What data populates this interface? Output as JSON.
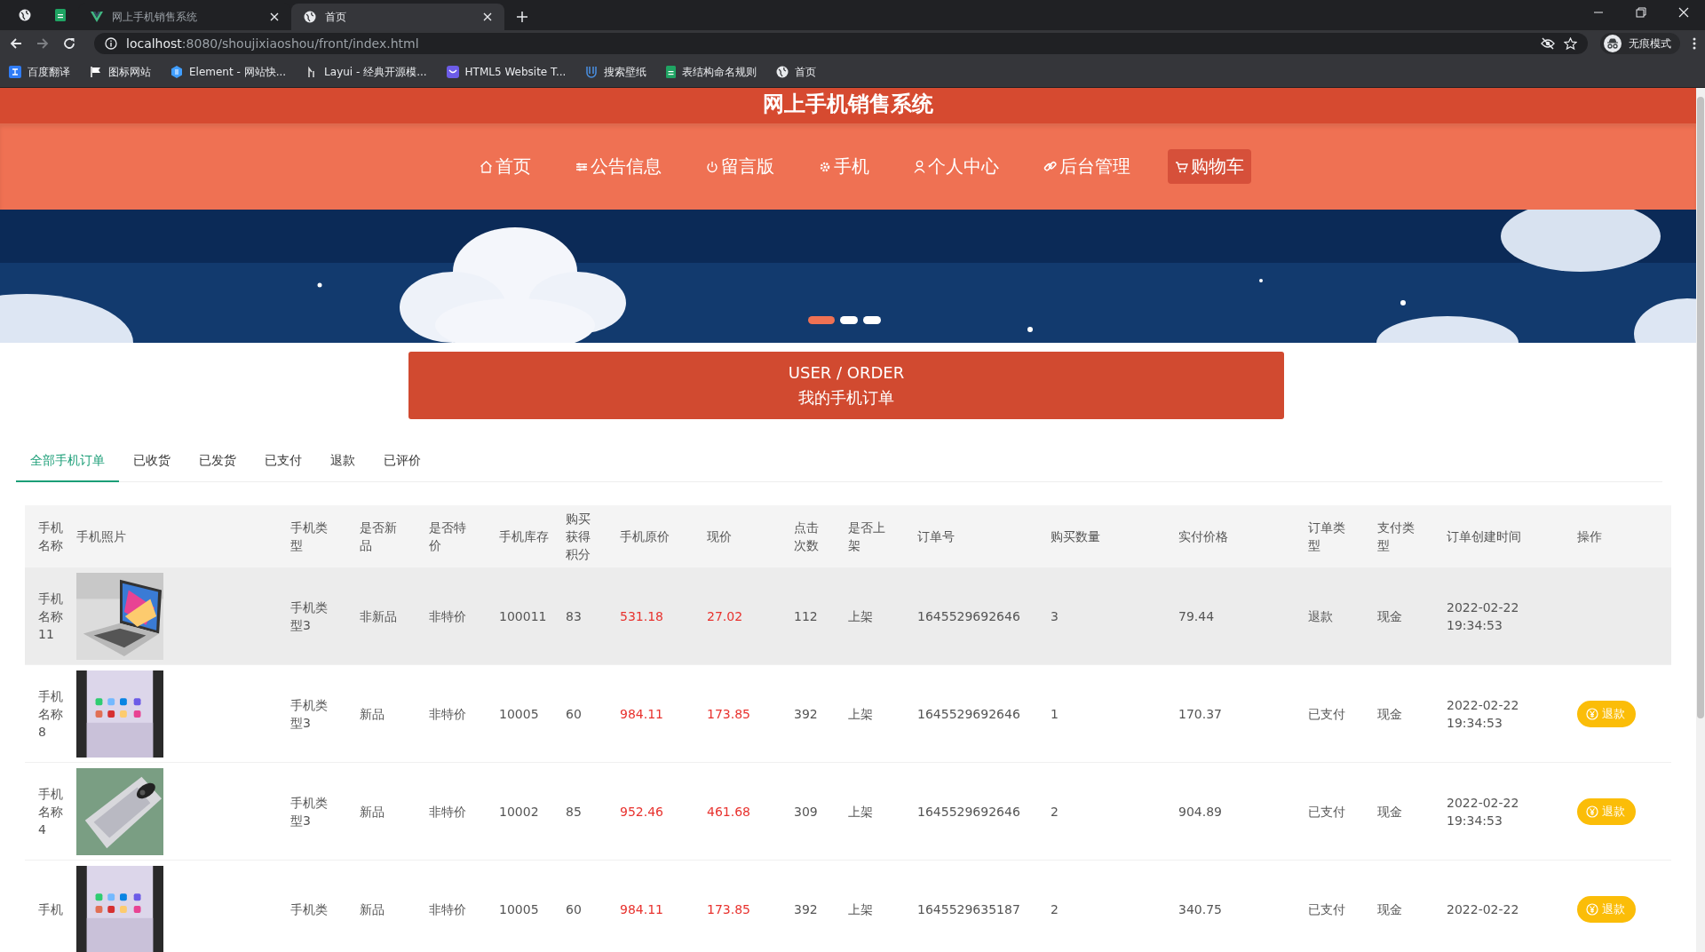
{
  "browser": {
    "pinned_tabs": [
      {
        "kind": "globe"
      },
      {
        "kind": "sheet"
      }
    ],
    "tabs": [
      {
        "kind": "vue",
        "title": "网上手机销售系统",
        "selected": false
      },
      {
        "kind": "globe",
        "title": "首页",
        "selected": true
      }
    ],
    "address": {
      "host": "localhost",
      "path": ":8080/shoujixiaoshou/front/index.html"
    },
    "profile": "无痕模式",
    "bookmarks": [
      {
        "kind": "translate",
        "label": "百度翻译"
      },
      {
        "kind": "flag",
        "label": "图标网站"
      },
      {
        "kind": "element",
        "label": "Element - 网站快..."
      },
      {
        "kind": "layui",
        "label": "Layui - 经典开源模..."
      },
      {
        "kind": "html5",
        "label": "HTML5 Website T..."
      },
      {
        "kind": "wallpaper",
        "label": "搜索壁纸"
      },
      {
        "kind": "sheet",
        "label": "表结构命名规则"
      },
      {
        "kind": "globe",
        "label": "首页"
      }
    ]
  },
  "site_title": "网上手机销售系统",
  "nav": [
    {
      "label": "首页",
      "selected": false
    },
    {
      "label": "公告信息",
      "selected": false
    },
    {
      "label": "留言版",
      "selected": false
    },
    {
      "label": "手机",
      "selected": false
    },
    {
      "label": "个人中心",
      "selected": false
    },
    {
      "label": "后台管理",
      "selected": false
    },
    {
      "label": "购物车",
      "selected": true
    }
  ],
  "carousel": [
    {
      "selected": true
    },
    {
      "selected": false
    },
    {
      "selected": false
    }
  ],
  "section": {
    "title": "USER / ORDER",
    "subtitle": "我的手机订单"
  },
  "order_tabs": [
    {
      "label": "全部手机订单",
      "selected": true
    },
    {
      "label": "已收货",
      "selected": false
    },
    {
      "label": "已发货",
      "selected": false
    },
    {
      "label": "已支付",
      "selected": false
    },
    {
      "label": "退款",
      "selected": false
    },
    {
      "label": "已评价",
      "selected": false
    }
  ],
  "table": {
    "columns": [
      {
        "label": "手机名称",
        "kind": "text"
      },
      {
        "label": "手机照片"
      },
      {
        "label": "手机类型",
        "kind": "text"
      },
      {
        "label": "是否新品",
        "kind": "text"
      },
      {
        "label": "是否特价",
        "kind": "text"
      },
      {
        "label": "手机库存",
        "kind": "text"
      },
      {
        "label": "购买获得积分",
        "kind": "text"
      },
      {
        "label": "手机原价",
        "kind": "price"
      },
      {
        "label": "现价",
        "kind": "price"
      },
      {
        "label": "点击次数",
        "kind": "text"
      },
      {
        "label": "是否上架",
        "kind": "text"
      },
      {
        "label": "订单号",
        "kind": "text"
      },
      {
        "label": "购买数量",
        "kind": "text"
      },
      {
        "label": "实付价格",
        "kind": "text"
      },
      {
        "label": "订单类型",
        "kind": "text"
      },
      {
        "label": "支付类型",
        "kind": "text"
      },
      {
        "label": "订单创建时间",
        "kind": "text"
      },
      {
        "label": "操作",
        "kind": "action"
      }
    ],
    "rows": [
      {
        "hovered": true,
        "values": [
          "手机名称11",
          "手机类型3",
          "非新品",
          "非特价",
          "100011",
          "83",
          "531.18",
          "27.02",
          "112",
          "上架",
          "1645529692646",
          "3",
          "79.44",
          "退款",
          "现金",
          "2022-02-22 19:34:53"
        ]
      },
      {
        "hovered": false,
        "values": [
          "手机名称8",
          "手机类型3",
          "新品",
          "非特价",
          "10005",
          "60",
          "984.11",
          "173.85",
          "392",
          "上架",
          "1645529692646",
          "1",
          "170.37",
          "已支付",
          "现金",
          "2022-02-22 19:34:53"
        ],
        "action": "退款"
      },
      {
        "hovered": false,
        "values": [
          "手机名称4",
          "手机类型3",
          "新品",
          "非特价",
          "10002",
          "85",
          "952.46",
          "461.68",
          "309",
          "上架",
          "1645529692646",
          "2",
          "904.89",
          "已支付",
          "现金",
          "2022-02-22 19:34:53"
        ],
        "action": "退款"
      },
      {
        "hovered": false,
        "values": [
          "手机",
          "手机类",
          "新品",
          "非特价",
          "10005",
          "60",
          "984.11",
          "173.85",
          "392",
          "上架",
          "1645529635187",
          "2",
          "340.75",
          "已支付",
          "现金",
          "2022-02-22"
        ],
        "action": "退款"
      }
    ]
  }
}
